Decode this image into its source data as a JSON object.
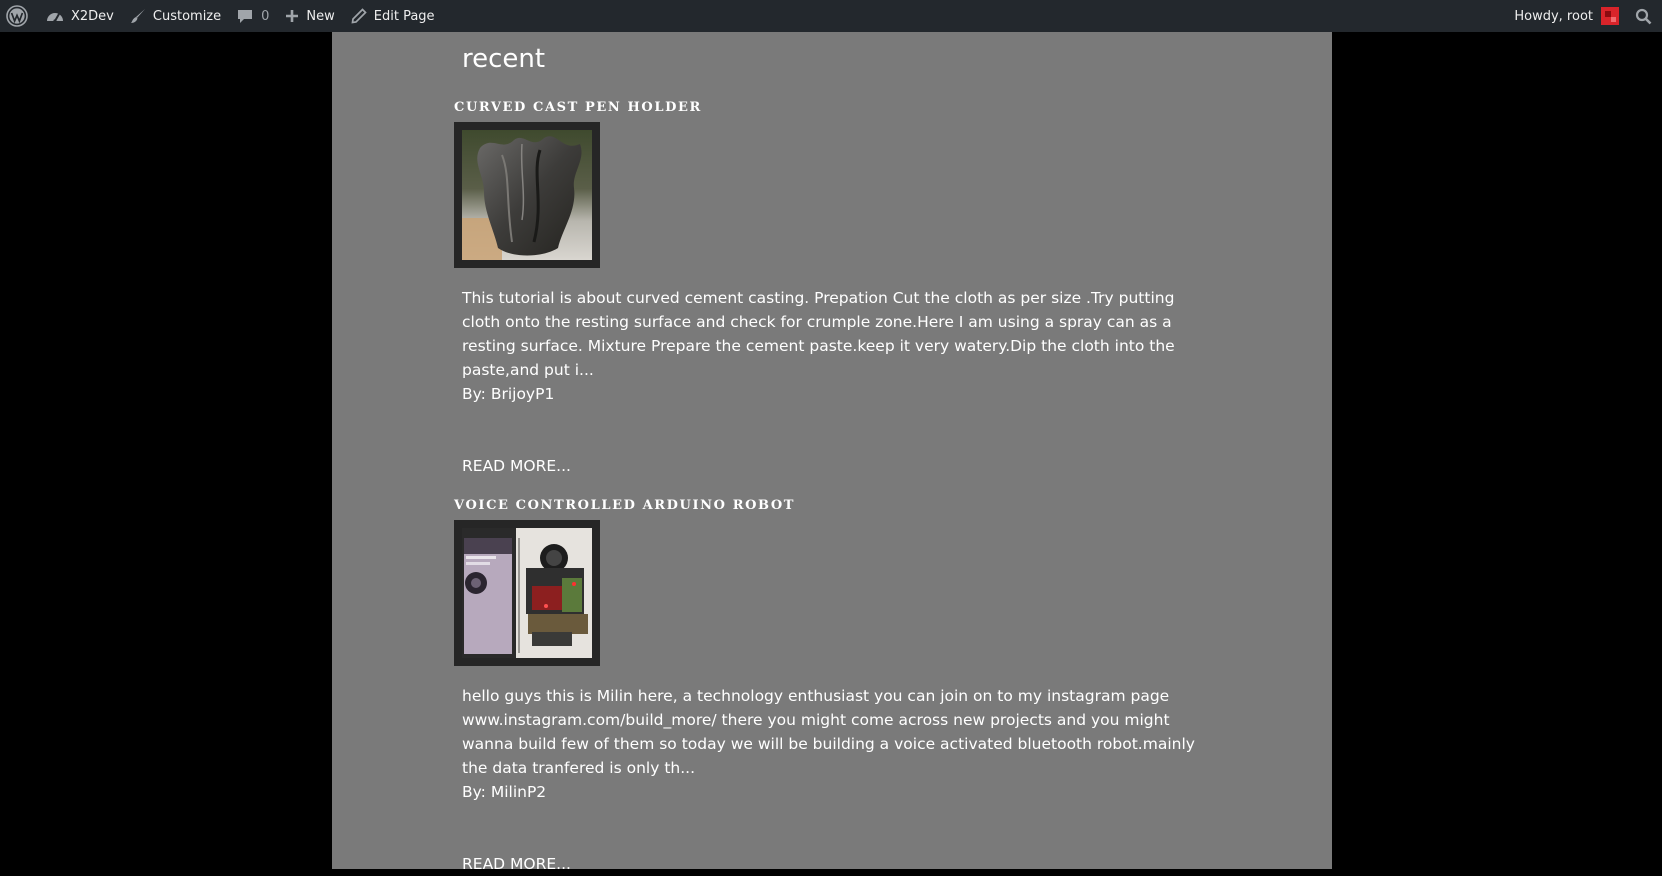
{
  "adminbar": {
    "site_name": "X2Dev",
    "customize": "Customize",
    "comments_count": "0",
    "new": "New",
    "edit_page": "Edit Page",
    "howdy": "Howdy, root"
  },
  "main": {
    "section_title": "recent",
    "posts": [
      {
        "title": "CURVED CAST PEN HOLDER",
        "excerpt": "This tutorial is about curved cement casting. Prepation Cut the cloth as per size .Try putting cloth onto the resting surface and check for crumple zone.Here I am using a spray can as a resting surface. Mixture Prepare the cement paste.keep it very watery.Dip the cloth into the paste,and put i...",
        "author": "By: BrijoyP1",
        "read_more": "READ MORE..."
      },
      {
        "title": "VOICE CONTROLLED ARDUINO ROBOT",
        "excerpt": "hello guys this is Milin here, a technology enthusiast you can join on to my instagram page www.instagram.com/build_more/ there you might come across new projects and you might wanna build few of them so today we will be building a voice activated bluetooth robot.mainly the data tranfered is only th...",
        "author": "By: MilinP2",
        "read_more": "READ MORE..."
      }
    ]
  },
  "colors": {
    "adminbar_bg": "#23282d",
    "page_bg": "#7a7a7a",
    "body_bg": "#000000",
    "text": "#ffffff"
  }
}
